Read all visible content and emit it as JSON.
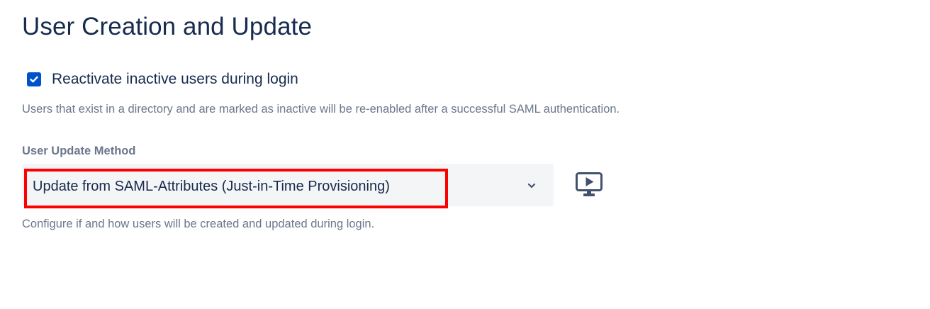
{
  "section": {
    "title": "User Creation and Update"
  },
  "reactivate": {
    "label": "Reactivate inactive users during login",
    "checked": true,
    "help": "Users that exist in a directory and are marked as inactive will be re-enabled after a successful SAML authentication."
  },
  "update_method": {
    "label": "User Update Method",
    "selected": "Update from SAML-Attributes (Just-in-Time Provisioning)",
    "help": "Configure if and how users will be created and updated during login."
  },
  "colors": {
    "checkbox": "#0052cc",
    "highlight": "#ff0000",
    "select_bg": "#f4f5f7",
    "icon": "#42526e"
  },
  "icons": {
    "checkbox": "checkmark-icon",
    "select": "chevron-down-icon",
    "tutorial": "video-tutorial-icon"
  }
}
